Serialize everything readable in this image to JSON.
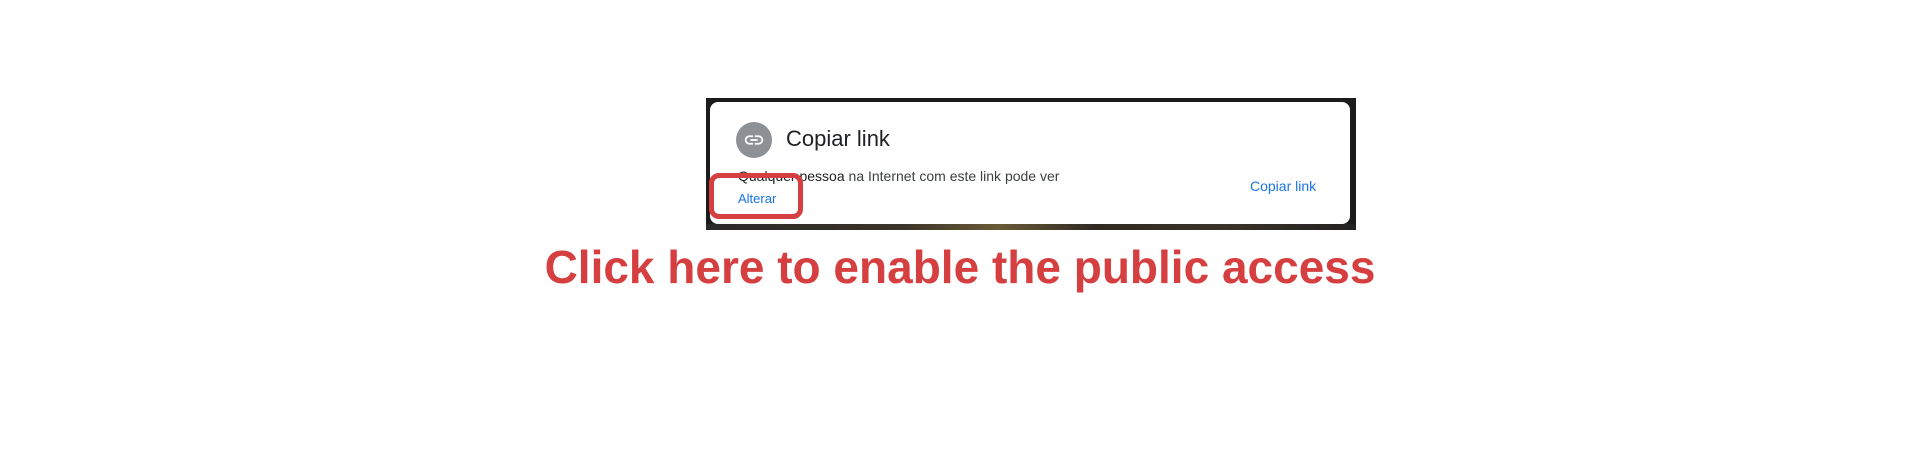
{
  "dialog": {
    "title": "Copiar link",
    "access_who": "Qualquer pessoa",
    "access_rest": "na Internet com este link pode ver",
    "change_label": "Alterar",
    "copy_link_label": "Copiar link",
    "icon": "link-icon"
  },
  "annotation": {
    "instruction": "Click here to enable the public access",
    "highlight_color": "#d63f40"
  },
  "colors": {
    "accent_blue": "#1a73e8",
    "icon_circle": "#8d9196"
  }
}
